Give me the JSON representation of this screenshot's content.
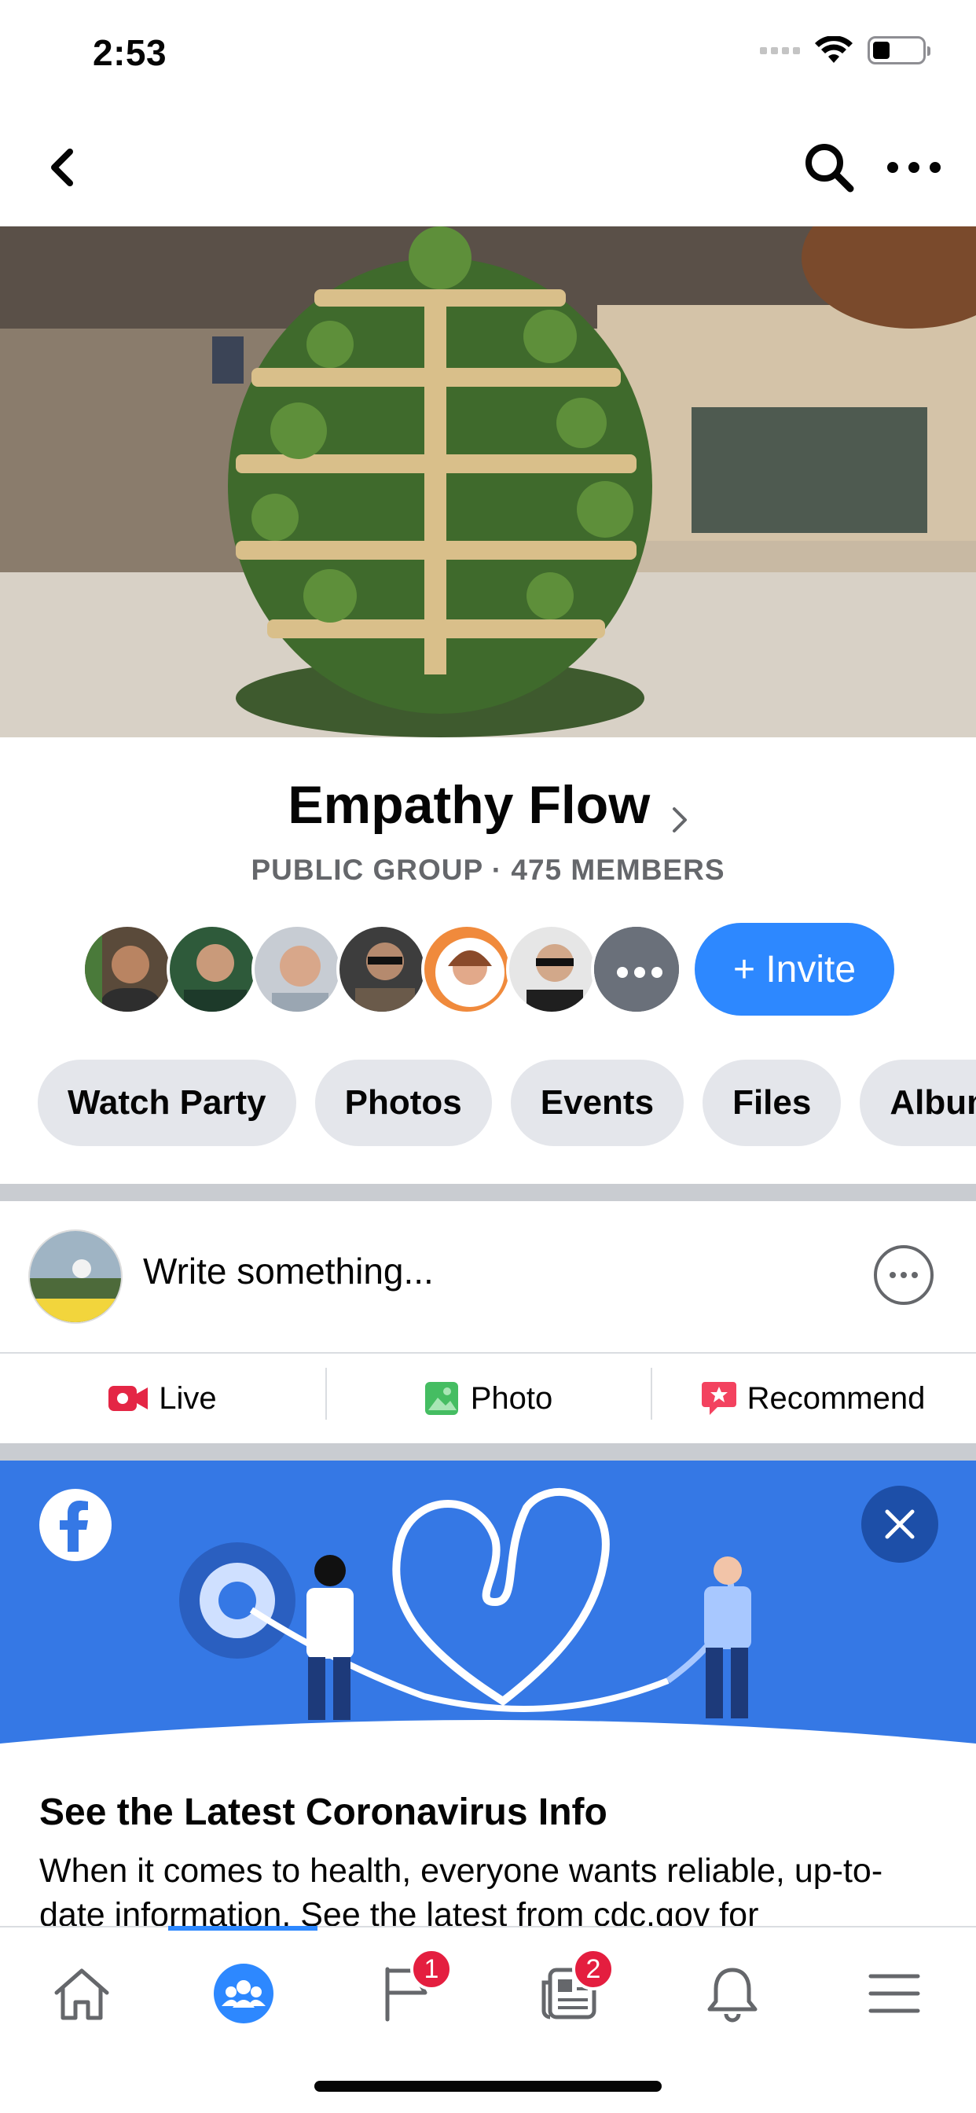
{
  "status_bar": {
    "time": "2:53",
    "battery_level": 0.35
  },
  "nav": {
    "back_icon": "chevron-left-icon",
    "search_icon": "search-icon",
    "more_icon": "more-horizontal-icon"
  },
  "group": {
    "name": "Empathy Flow",
    "meta": "PUBLIC GROUP · 475 MEMBERS",
    "invite_label": "+ Invite"
  },
  "members": [
    {
      "name": "member-1",
      "color": "#5a4a3a"
    },
    {
      "name": "member-2",
      "color": "#2e5a3a"
    },
    {
      "name": "member-3",
      "color": "#c7ccd3"
    },
    {
      "name": "member-4",
      "color": "#3d3d3d"
    },
    {
      "name": "member-5",
      "color": "#f08a3c"
    },
    {
      "name": "member-6",
      "color": "#e6e6e6"
    },
    {
      "name": "member-7",
      "color": "#4a4f5a"
    }
  ],
  "chips": [
    "Watch Party",
    "Photos",
    "Events",
    "Files",
    "Albums"
  ],
  "composer": {
    "placeholder": "Write something..."
  },
  "actions": [
    {
      "label": "Live",
      "icon": "live-video-icon",
      "color": "#e42645"
    },
    {
      "label": "Photo",
      "icon": "photo-icon",
      "color": "#45bd62"
    },
    {
      "label": "Recommend",
      "icon": "recommend-icon",
      "color": "#f3425f"
    }
  ],
  "promo": {
    "title": "See the Latest Coronavirus Info",
    "body": "When it comes to health, everyone wants reliable, up-to-date information. See the latest from cdc.gov for"
  },
  "tab_bar": {
    "tabs": [
      {
        "name": "home",
        "icon": "home-icon"
      },
      {
        "name": "groups",
        "icon": "groups-icon"
      },
      {
        "name": "pages",
        "icon": "pages-flag-icon",
        "badge": "1"
      },
      {
        "name": "news",
        "icon": "news-icon",
        "badge": "2"
      },
      {
        "name": "notifications",
        "icon": "bell-icon"
      },
      {
        "name": "menu",
        "icon": "menu-icon"
      }
    ]
  },
  "colors": {
    "accent": "#2d88ff",
    "promo_blue": "#3578e5",
    "badge_red": "#e41e3f"
  }
}
